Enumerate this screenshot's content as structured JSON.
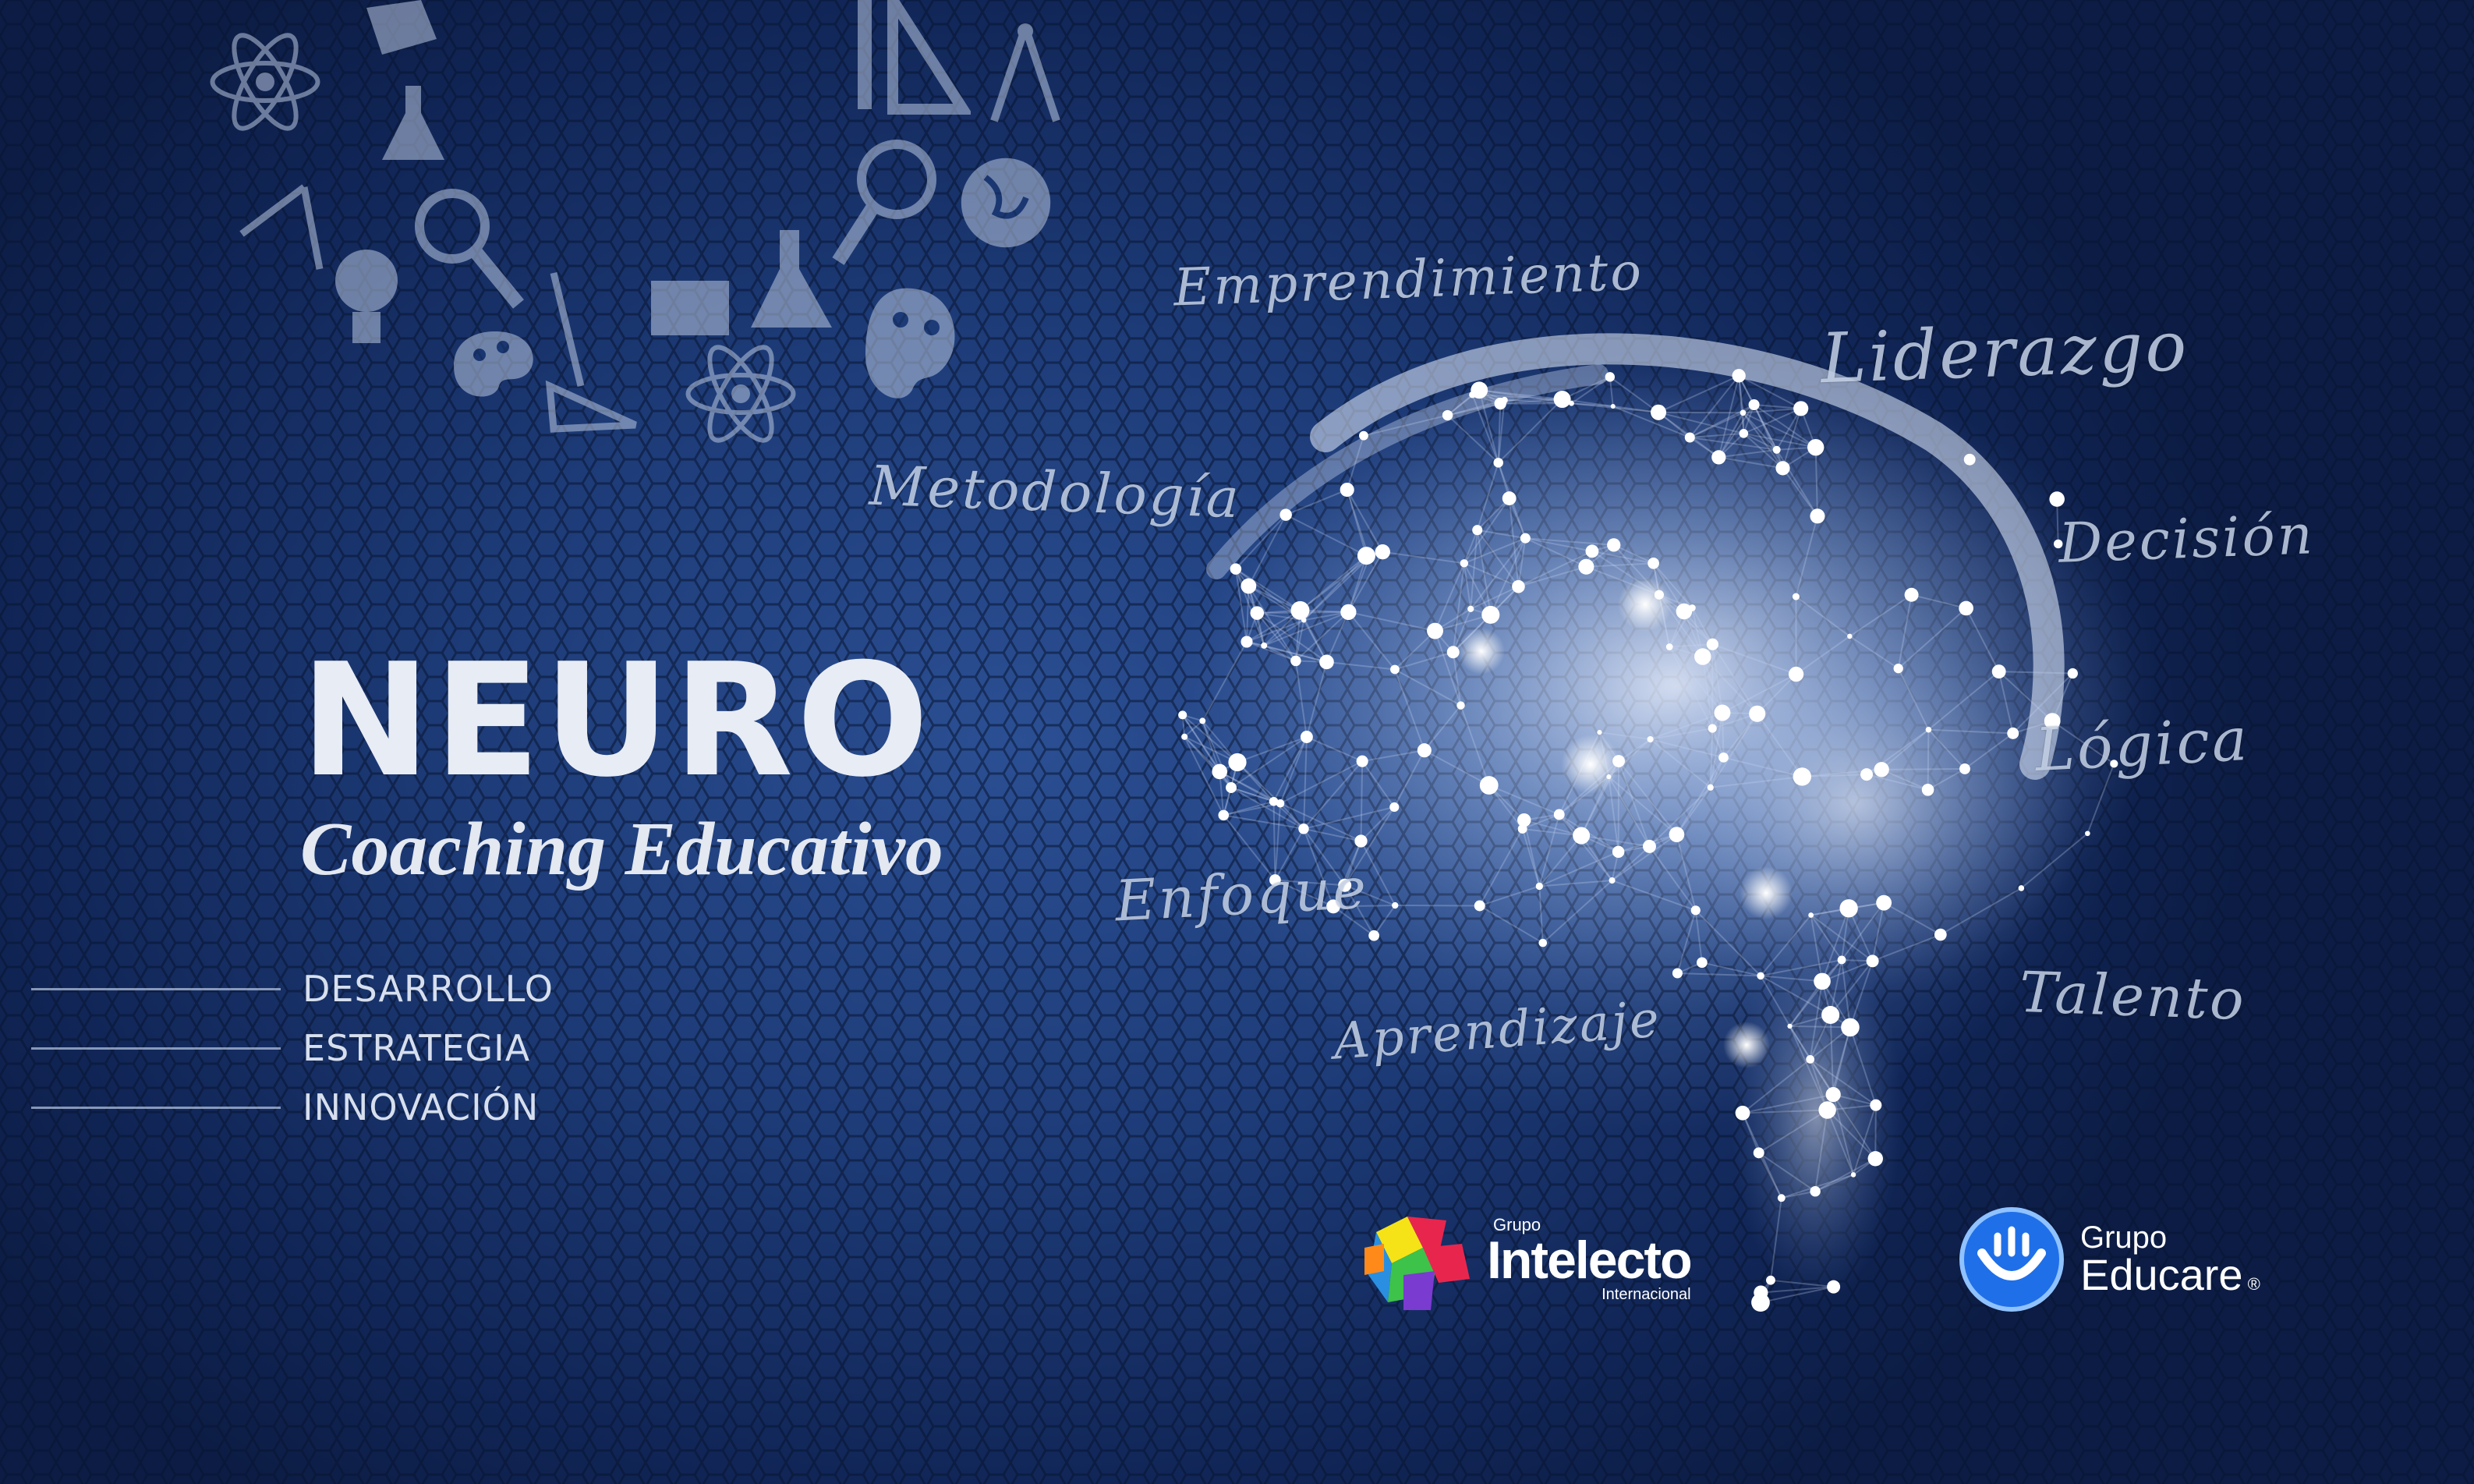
{
  "hero": {
    "title": "NEURO",
    "subtitle": "Coaching Educativo",
    "features": [
      "DESARROLLO",
      "ESTRATEGIA",
      "INNOVACIÓN"
    ]
  },
  "brain_keywords": {
    "emprendimiento": "Emprendimiento",
    "liderazgo": "Liderazgo",
    "metodologia": "Metodología",
    "decision": "Decisión",
    "logica": "Lógica",
    "enfoque": "Enfoque",
    "talento": "Talento",
    "aprendizaje": "Aprendizaje"
  },
  "logos": {
    "intelecto": {
      "top": "Grupo",
      "name": "Intelecto",
      "bottom": "Internacional"
    },
    "educare": {
      "top": "Grupo",
      "name": "Educare",
      "mark": "®"
    }
  },
  "colors": {
    "background": "#1d3b77",
    "text": "#e8ecf4",
    "glow": "#ffffff"
  },
  "icons": [
    "atom-icon",
    "notepad-icon",
    "flask-icon",
    "set-square-icon",
    "compass-icon",
    "magnifier-icon",
    "globe-icon",
    "lightbulb-icon",
    "palette-icon",
    "folder-icon"
  ]
}
